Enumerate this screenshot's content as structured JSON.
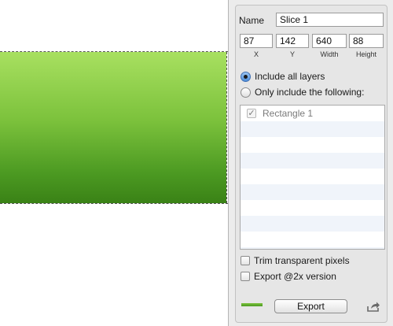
{
  "inspector": {
    "name_label": "Name",
    "name_value": "Slice 1",
    "x_value": "87",
    "y_value": "142",
    "width_value": "640",
    "height_value": "88",
    "x_caption": "X",
    "y_caption": "Y",
    "width_caption": "Width",
    "height_caption": "Height",
    "radio_include_all": "Include all layers",
    "radio_only_include": "Only include the following:",
    "include_all_selected": true,
    "layers": [
      {
        "name": "Rectangle 1",
        "checked": true
      }
    ],
    "trim_label": "Trim transparent pixels",
    "trim_checked": false,
    "retina_label": "Export @2x version",
    "retina_checked": false,
    "export_label": "Export",
    "swatch_color": "#5fae2e",
    "icons": [
      "checkmark-icon",
      "share-icon"
    ]
  },
  "canvas": {
    "slice_colors": [
      "#a8e060",
      "#3a8216"
    ]
  }
}
